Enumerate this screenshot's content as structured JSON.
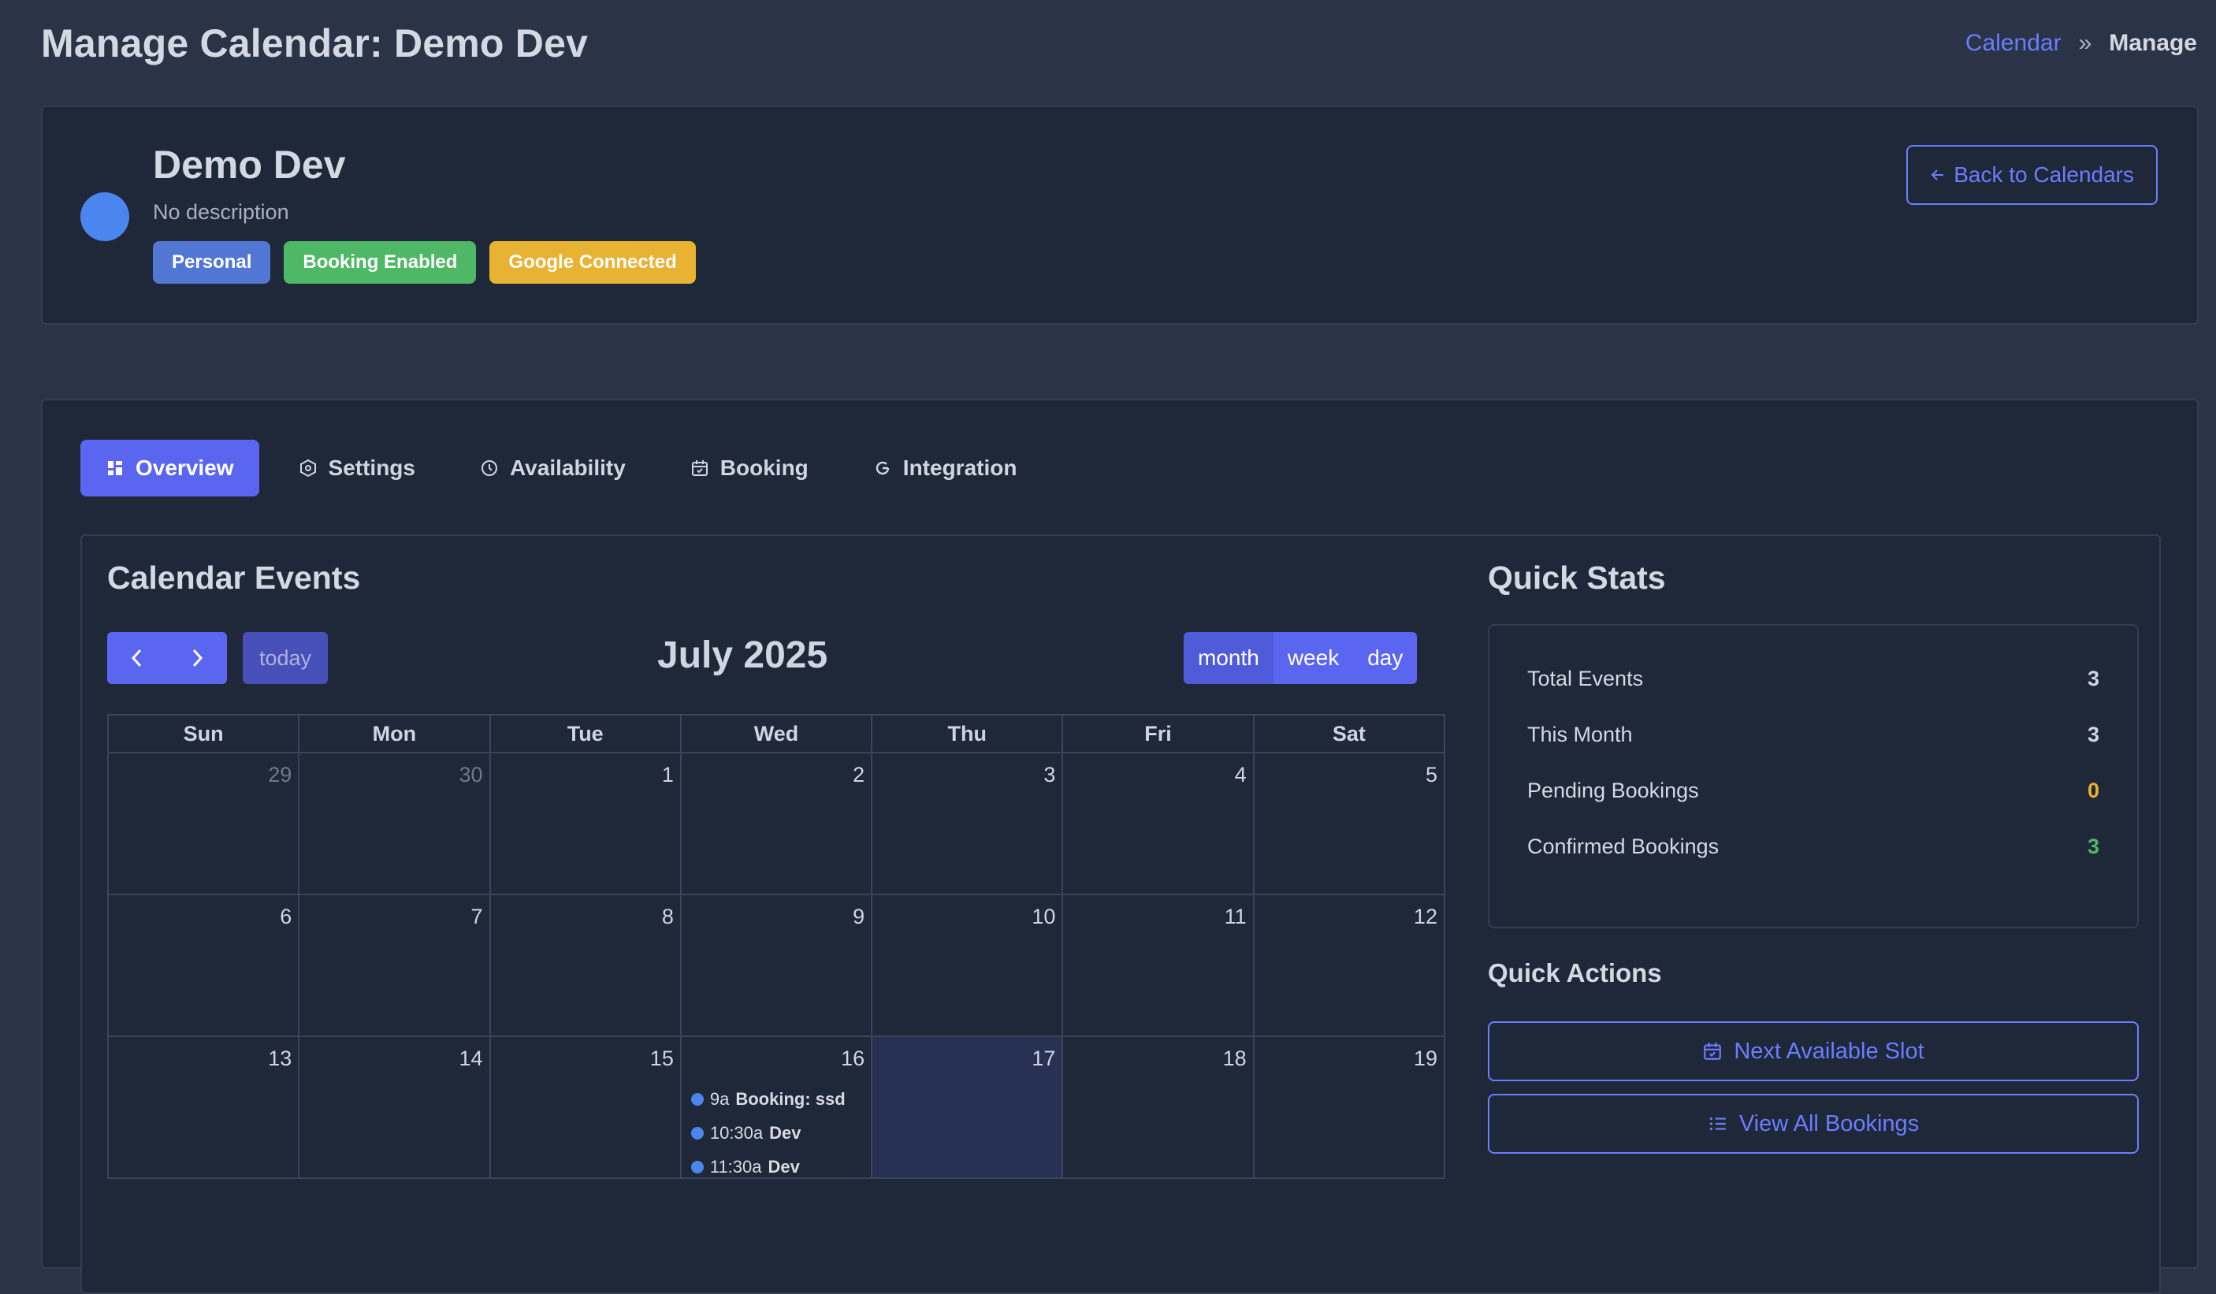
{
  "page": {
    "title": "Manage Calendar: Demo Dev"
  },
  "breadcrumb": {
    "link": "Calendar",
    "separator": "»",
    "current": "Manage"
  },
  "calendar_header": {
    "name": "Demo Dev",
    "description": "No description",
    "color": "#4b86ee",
    "badges": [
      {
        "label": "Personal",
        "color": "#5176d3"
      },
      {
        "label": "Booking Enabled",
        "color": "#4fb866"
      },
      {
        "label": "Google Connected",
        "color": "#e8b232"
      }
    ],
    "back_button": "Back to Calendars"
  },
  "tabs": [
    {
      "label": "Overview",
      "icon": "dashboard-icon",
      "active": true
    },
    {
      "label": "Settings",
      "icon": "gear-icon"
    },
    {
      "label": "Availability",
      "icon": "clock-icon"
    },
    {
      "label": "Booking",
      "icon": "calendar-check-icon"
    },
    {
      "label": "Integration",
      "icon": "google-icon"
    }
  ],
  "events_section": {
    "title": "Calendar Events",
    "today_label": "today",
    "month_title": "July 2025",
    "views": [
      "month",
      "week",
      "day"
    ],
    "weekdays": [
      "Sun",
      "Mon",
      "Tue",
      "Wed",
      "Thu",
      "Fri",
      "Sat"
    ],
    "weeks": [
      [
        "29",
        "30",
        "1",
        "2",
        "3",
        "4",
        "5"
      ],
      [
        "6",
        "7",
        "8",
        "9",
        "10",
        "11",
        "12"
      ],
      [
        "13",
        "14",
        "15",
        "16",
        "17",
        "18",
        "19"
      ]
    ],
    "events": [
      {
        "time": "9a",
        "title": "Booking: ssd"
      },
      {
        "time": "10:30a",
        "title": "Dev"
      },
      {
        "time": "11:30a",
        "title": "Dev"
      }
    ]
  },
  "quick_stats": {
    "title": "Quick Stats",
    "items": [
      {
        "label": "Total Events",
        "value": "3"
      },
      {
        "label": "This Month",
        "value": "3"
      },
      {
        "label": "Pending Bookings",
        "value": "0"
      },
      {
        "label": "Confirmed Bookings",
        "value": "3"
      }
    ]
  },
  "quick_actions": {
    "title": "Quick Actions",
    "next_slot": "Next Available Slot",
    "view_all": "View All Bookings"
  },
  "colors": {
    "accent": "#5a65f0",
    "link": "#6a7dff",
    "today_bg": "#263154"
  }
}
